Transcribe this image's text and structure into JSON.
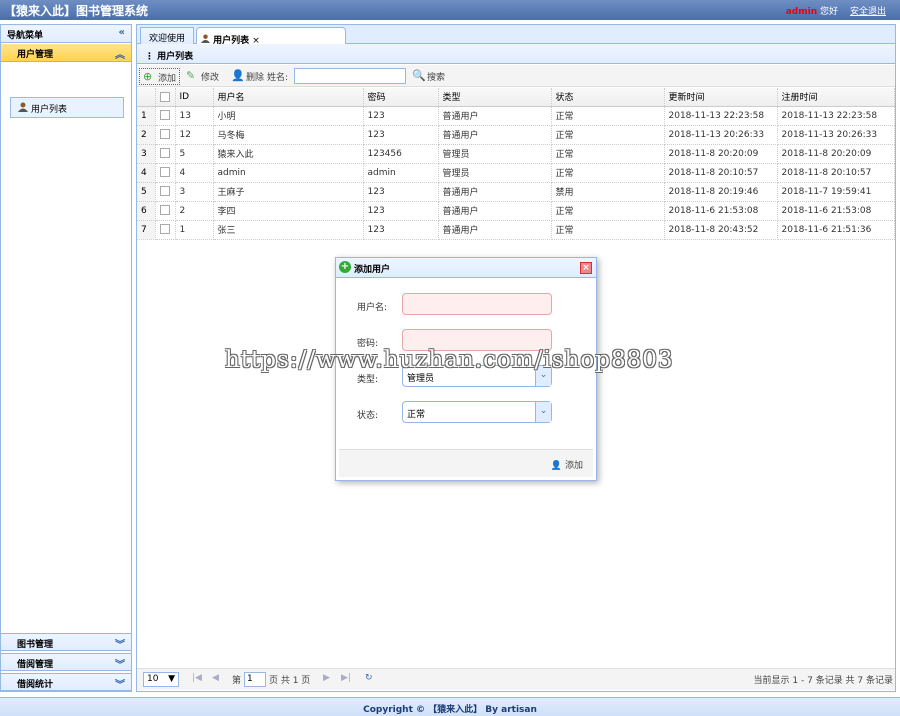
{
  "header": {
    "title": "【猿来入此】图书管理系统",
    "user": "admin",
    "greeting": "您好",
    "logout": "安全退出"
  },
  "sidebar": {
    "title": "导航菜单",
    "collapse_icon": "«",
    "active_group": "用户管理",
    "tree_item": "用户列表",
    "groups": [
      "图书管理",
      "借阅管理",
      "借阅统计"
    ]
  },
  "tabs": [
    "欢迎使用",
    "用户列表"
  ],
  "tab_close": "×",
  "list_title": "用户列表",
  "toolbar": {
    "add": "添加",
    "edit": "修改",
    "delete": "删除",
    "name_label": "姓名:",
    "search": "搜索"
  },
  "columns": [
    "ID",
    "用户名",
    "密码",
    "类型",
    "状态",
    "更新时间",
    "注册时间"
  ],
  "rows": [
    [
      "1",
      "13",
      "小明",
      "123",
      "普通用户",
      "正常",
      "2018-11-13 22:23:58",
      "2018-11-13 22:23:58"
    ],
    [
      "2",
      "12",
      "马冬梅",
      "123",
      "普通用户",
      "正常",
      "2018-11-13 20:26:33",
      "2018-11-13 20:26:33"
    ],
    [
      "3",
      "5",
      "猿来入此",
      "123456",
      "管理员",
      "正常",
      "2018-11-8 20:20:09",
      "2018-11-8 20:20:09"
    ],
    [
      "4",
      "4",
      "admin",
      "admin",
      "管理员",
      "正常",
      "2018-11-8 20:10:57",
      "2018-11-8 20:10:57"
    ],
    [
      "5",
      "3",
      "王麻子",
      "123",
      "普通用户",
      "禁用",
      "2018-11-8 20:19:46",
      "2018-11-7 19:59:41"
    ],
    [
      "6",
      "2",
      "李四",
      "123",
      "普通用户",
      "正常",
      "2018-11-6 21:53:08",
      "2018-11-6 21:53:08"
    ],
    [
      "7",
      "1",
      "张三",
      "123",
      "普通用户",
      "正常",
      "2018-11-8 20:43:52",
      "2018-11-6 21:51:36"
    ]
  ],
  "pager": {
    "page_size": "10",
    "page_prefix": "第",
    "page": "1",
    "page_suffix": "页 共 1 页",
    "summary": "当前显示 1 - 7 条记录 共 7 条记录"
  },
  "dialog": {
    "title": "添加用户",
    "username_label": "用户名:",
    "password_label": "密码:",
    "type_label": "类型:",
    "type_value": "管理员",
    "status_label": "状态:",
    "status_value": "正常",
    "submit": "添加"
  },
  "watermark": "https://www.huzhan.com/ishop8803",
  "footer": "Copyright © 【猿来入此】 By artisan"
}
